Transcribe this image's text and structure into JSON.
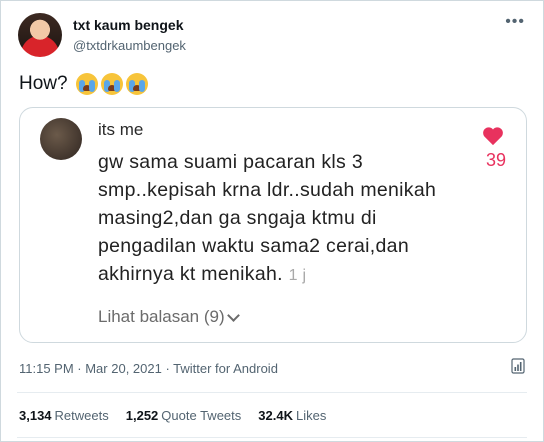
{
  "author": {
    "name": "txt kaum bengek",
    "handle": "@txtdrkaumbengek",
    "avatar_icon": "profile-photo"
  },
  "tweet": {
    "text": "How?",
    "emojis": [
      "loudly-crying-face",
      "loudly-crying-face",
      "loudly-crying-face"
    ]
  },
  "embedded_comment": {
    "username": "its me",
    "body": "gw sama suami pacaran kls 3 smp..kepisah krna ldr..sudah menikah masing2,dan ga sngaja ktmu di pengadilan waktu sama2 cerai,dan akhirnya kt menikah.",
    "time": "1 j",
    "likes": "39",
    "replies_label": "Lihat balasan (9)",
    "like_color": "#e8325e"
  },
  "meta": {
    "timestamp": "11:15 PM · Mar 20, 2021 · Twitter for Android"
  },
  "stats": {
    "retweets_count": "3,134",
    "retweets_label": "Retweets",
    "quotes_count": "1,252",
    "quotes_label": "Quote Tweets",
    "likes_count": "32.4K",
    "likes_label": "Likes"
  }
}
